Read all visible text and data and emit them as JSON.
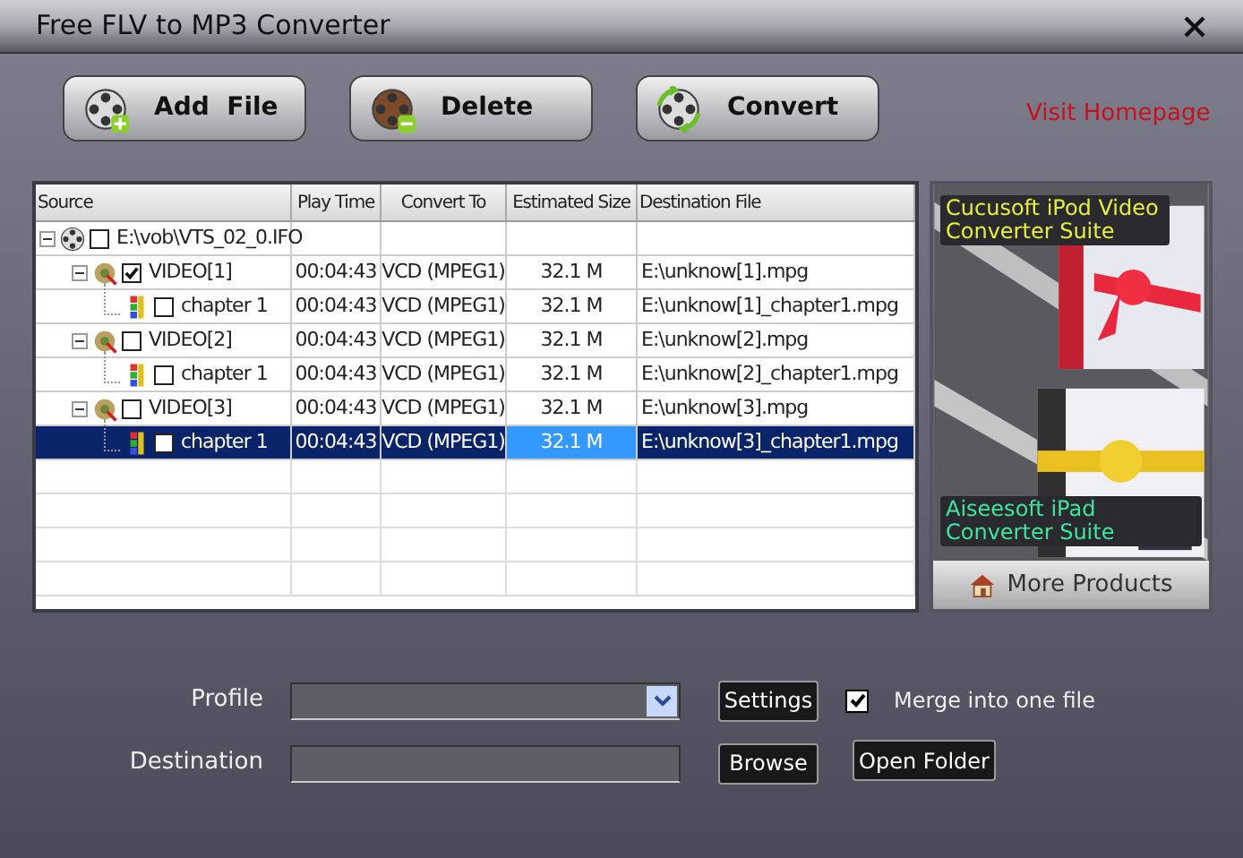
{
  "window": {
    "title": "Free FLV to MP3 Converter"
  },
  "toolbar": [
    {
      "kind": "add",
      "label": "Add  File"
    },
    {
      "kind": "delete",
      "label": "Delete"
    },
    {
      "kind": "convert",
      "label": "Convert"
    }
  ],
  "visit_link": "Visit Homepage",
  "table": {
    "columns": [
      "Source",
      "Play Time",
      "Convert To",
      "Estimated Size",
      "Destination File"
    ],
    "tree": [
      {
        "kind": "disc",
        "source": "E:\\vob\\VTS_02_0.IFO",
        "checked": false,
        "expanded": true,
        "selected": false,
        "children": [
          {
            "kind": "video",
            "source": "VIDEO[1]",
            "checked": true,
            "expanded": true,
            "selected": false,
            "play_time": "00:04:43",
            "convert_to": "VCD (MPEG1)",
            "estimated_size": "32.1 M",
            "destination_file": "E:\\unknow[1].mpg",
            "children": [
              {
                "kind": "chapter",
                "source": "chapter 1",
                "checked": false,
                "selected": false,
                "play_time": "00:04:43",
                "convert_to": "VCD (MPEG1)",
                "estimated_size": "32.1 M",
                "destination_file": "E:\\unknow[1]_chapter1.mpg"
              }
            ]
          },
          {
            "kind": "video",
            "source": "VIDEO[2]",
            "checked": false,
            "expanded": true,
            "selected": false,
            "play_time": "00:04:43",
            "convert_to": "VCD (MPEG1)",
            "estimated_size": "32.1 M",
            "destination_file": "E:\\unknow[2].mpg",
            "children": [
              {
                "kind": "chapter",
                "source": "chapter 1",
                "checked": false,
                "selected": false,
                "play_time": "00:04:43",
                "convert_to": "VCD (MPEG1)",
                "estimated_size": "32.1 M",
                "destination_file": "E:\\unknow[2]_chapter1.mpg"
              }
            ]
          },
          {
            "kind": "video",
            "source": "VIDEO[3]",
            "checked": false,
            "expanded": true,
            "selected": false,
            "play_time": "00:04:43",
            "convert_to": "VCD (MPEG1)",
            "estimated_size": "32.1 M",
            "destination_file": "E:\\unknow[3].mpg",
            "children": [
              {
                "kind": "chapter",
                "source": "chapter 1",
                "checked": false,
                "selected": true,
                "play_time": "00:04:43",
                "convert_to": "VCD (MPEG1)",
                "estimated_size": "32.1 M",
                "destination_file": "E:\\unknow[3]_chapter1.mpg"
              }
            ]
          }
        ]
      }
    ]
  },
  "ad": {
    "products": [
      {
        "text": "Cucusoft iPod Video Converter Suite"
      },
      {
        "text": "Aiseesoft iPad Converter Suite"
      }
    ],
    "more_button": "More Products"
  },
  "profile": {
    "label": "Profile",
    "settings_button": "Settings"
  },
  "merge": {
    "label": "Merge into one file",
    "checked": true
  },
  "destination": {
    "label": "Destination",
    "browse_button": "Browse",
    "open_folder_button": "Open Folder"
  }
}
